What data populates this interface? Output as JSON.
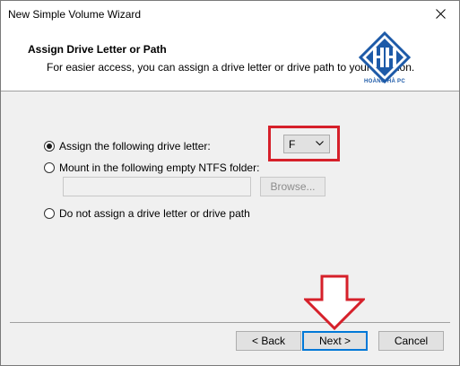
{
  "window": {
    "title": "New Simple Volume Wizard"
  },
  "header": {
    "title": "Assign Drive Letter or Path",
    "subtitle": "For easier access, you can assign a drive letter or drive path to your partition.",
    "logo_text": "HOÀNG HÀ PC"
  },
  "options": {
    "assign_letter": {
      "label": "Assign the following drive letter:",
      "checked": true
    },
    "mount_folder": {
      "label": "Mount in the following empty NTFS folder:",
      "checked": false
    },
    "no_assign": {
      "label": "Do not assign a drive letter or drive path",
      "checked": false
    }
  },
  "drive_letter": {
    "selected": "F"
  },
  "folder_path": {
    "value": ""
  },
  "buttons": {
    "browse": "Browse...",
    "back": "< Back",
    "next": "Next >",
    "cancel": "Cancel"
  },
  "colors": {
    "highlight": "#d6202a",
    "focus": "#0078d7",
    "logo": "#1d5aa8"
  },
  "icons": {
    "close": "close-icon",
    "dropdown": "chevron-down-icon",
    "annotation": "down-arrow-icon"
  }
}
